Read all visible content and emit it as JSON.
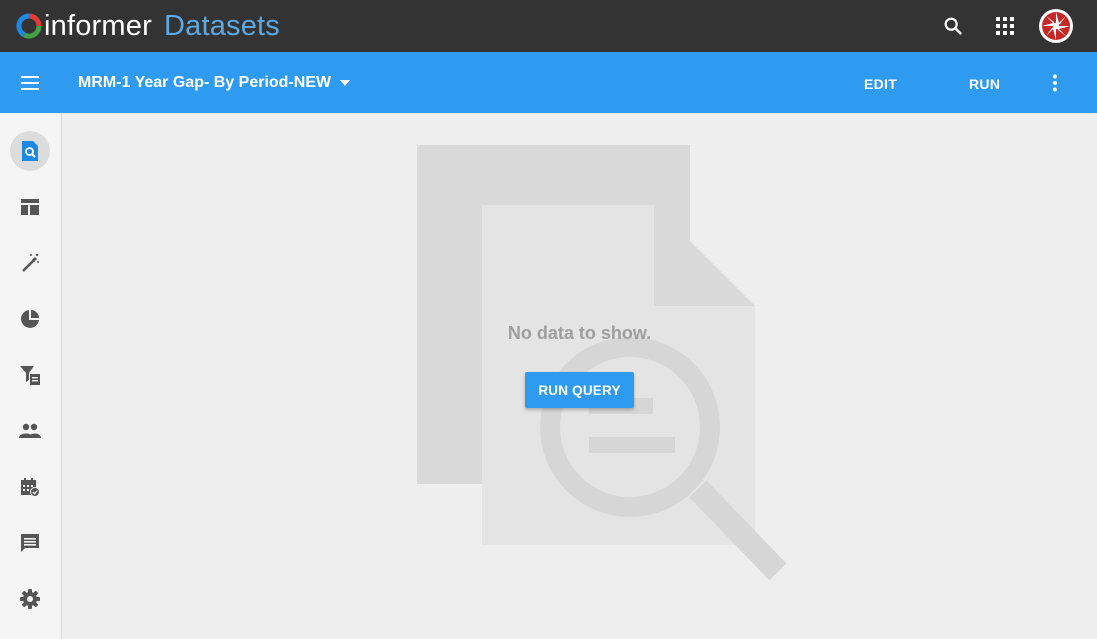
{
  "header": {
    "brand_name": "informer",
    "product_name": "Datasets",
    "icons": [
      "search-icon",
      "apps-grid-icon",
      "user-avatar"
    ]
  },
  "appbar": {
    "title": "MRM-1 Year Gap- By Period-NEW",
    "edit_label": "EDIT",
    "run_label": "RUN",
    "icons": [
      "menu-icon",
      "caret-down-icon",
      "more-vert-icon"
    ]
  },
  "sidebar": {
    "items": [
      {
        "name": "query-icon",
        "active": true
      },
      {
        "name": "layout-icon",
        "active": false
      },
      {
        "name": "magic-wand-icon",
        "active": false
      },
      {
        "name": "pie-chart-icon",
        "active": false
      },
      {
        "name": "filter-list-icon",
        "active": false
      },
      {
        "name": "people-icon",
        "active": false
      },
      {
        "name": "calendar-check-icon",
        "active": false
      },
      {
        "name": "comment-icon",
        "active": false
      },
      {
        "name": "settings-icon",
        "active": false
      }
    ]
  },
  "main": {
    "empty_message": "No data to show.",
    "run_query_label": "RUN QUERY"
  },
  "colors": {
    "topbar": "#333333",
    "accent": "#2e9bf0",
    "brand_product": "#5aa9e6",
    "background": "#eeeeee",
    "sidebar_icon": "#555555",
    "active_icon": "#1e88e5",
    "illustration": "#d8d8d8"
  }
}
